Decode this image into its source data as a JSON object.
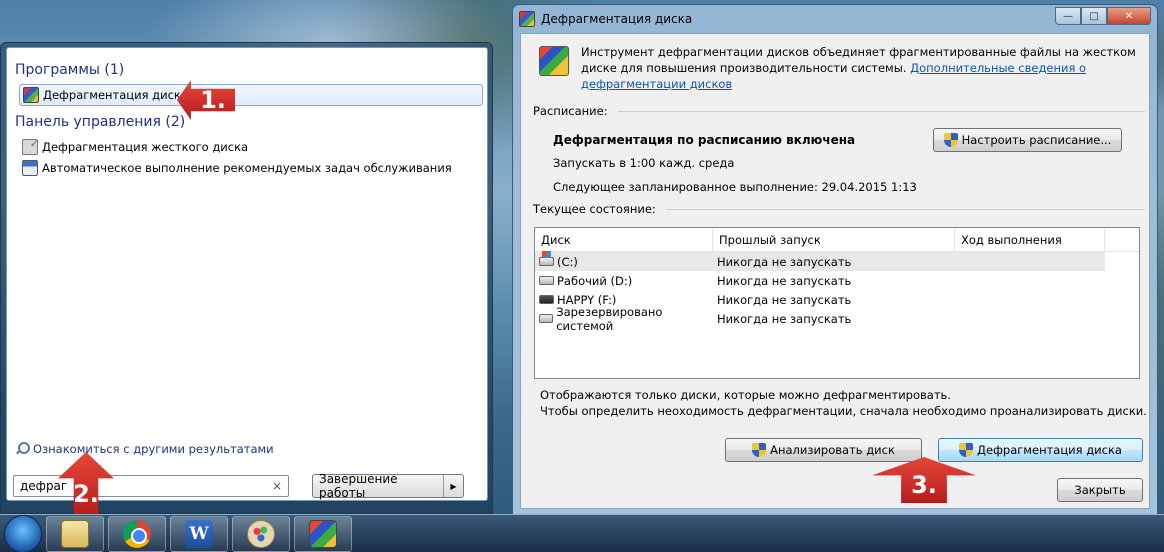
{
  "start_menu": {
    "programs_header": "Программы (1)",
    "programs": [
      {
        "label": "Дефрагментация диска",
        "icon": "defrag-icon"
      }
    ],
    "control_panel_header": "Панель управления (2)",
    "control_panel": [
      {
        "label": "Дефрагментация жесткого диска",
        "icon": "disk-check-icon"
      },
      {
        "label": "Автоматическое выполнение рекомендуемых задач обслуживания",
        "icon": "maintenance-icon"
      }
    ],
    "more_results": "Ознакомиться с другими результатами",
    "search_value": "дефраг",
    "search_clear": "×",
    "shutdown_label": "Завершение работы",
    "shutdown_arrow": "▶"
  },
  "annotations": {
    "step1": "1.",
    "step2": "2.",
    "step3": "3."
  },
  "window": {
    "title": "Дефрагментация диска",
    "controls": {
      "minimize": "—",
      "maximize": "□",
      "close": "✕"
    },
    "intro_text": "Инструмент дефрагментации дисков объединяет фрагментированные файлы на жестком диске для повышения производительности системы.",
    "intro_link": "Дополнительные сведения о дефрагментации дисков",
    "schedule_label": "Расписание:",
    "schedule_title": "Дефрагментация по расписанию включена",
    "schedule_run": "Запускать в 1:00 кажд. среда",
    "schedule_next": "Следующее запланированное выполнение: 29.04.2015 1:13",
    "configure_button": "Настроить расписание...",
    "status_label": "Текущее состояние:",
    "columns": [
      "Диск",
      "Прошлый запуск",
      "Ход выполнения"
    ],
    "disks": [
      {
        "name": "(C:)",
        "last": "Никогда не запускать",
        "progress": "",
        "icon": "os-drive-icon"
      },
      {
        "name": "Рабочий (D:)",
        "last": "Никогда не запускать",
        "progress": "",
        "icon": "drive-icon"
      },
      {
        "name": "HAPPY (F:)",
        "last": "Никогда не запускать",
        "progress": "",
        "icon": "usb-drive-icon"
      },
      {
        "name": "Зарезервировано системой",
        "last": "Никогда не запускать",
        "progress": "",
        "icon": "drive-icon"
      }
    ],
    "note1": "Отображаются только диски, которые можно дефрагментировать.",
    "note2": "Чтобы определить неоходимость  дефрагментации, сначала необходимо проанализировать диски.",
    "analyze_button": "Анализировать диск",
    "defrag_button": "Дефрагментация диска",
    "close_button": "Закрыть"
  },
  "taskbar": {
    "items": [
      "start-orb",
      "explorer-icon",
      "chrome-icon",
      "word-icon",
      "paint-icon",
      "defrag-icon"
    ],
    "word_glyph": "W"
  }
}
